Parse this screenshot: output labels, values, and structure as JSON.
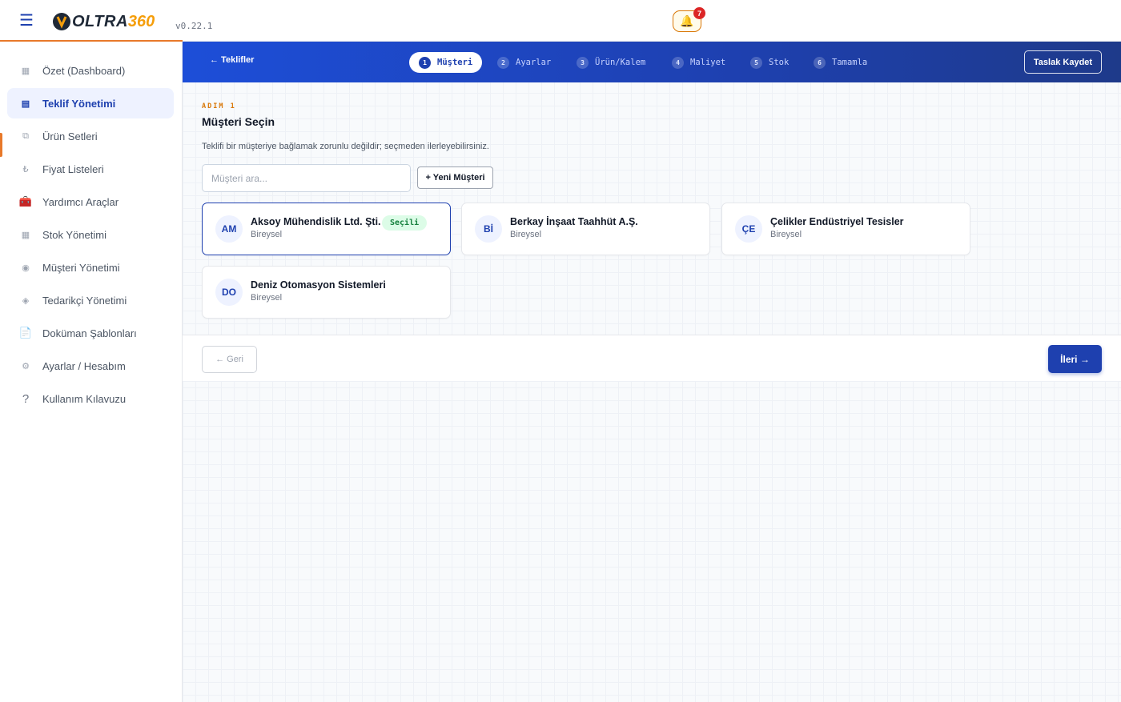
{
  "header": {
    "logo_word": "OLTRA",
    "logo_num": "360",
    "version": "v0.22.1",
    "notification_count": "7"
  },
  "sidebar": {
    "items": [
      {
        "label": "Özet (Dashboard)",
        "icon": "dashboard-icon"
      },
      {
        "label": "Teklif Yönetimi",
        "icon": "document-list-icon",
        "active": true
      },
      {
        "label": "Ürün Setleri",
        "icon": "box-icon"
      },
      {
        "label": "Fiyat Listeleri",
        "icon": "lira-icon"
      },
      {
        "label": "Yardımcı Araçlar",
        "icon": "toolbox-icon"
      },
      {
        "label": "Stok Yönetimi",
        "icon": "grid-icon"
      },
      {
        "label": "Müşteri Yönetimi",
        "icon": "target-icon"
      },
      {
        "label": "Tedarikçi Yönetimi",
        "icon": "diamond-icon"
      },
      {
        "label": "Doküman Şablonları",
        "icon": "file-icon"
      },
      {
        "label": "Ayarlar / Hesabım",
        "icon": "gear-icon"
      },
      {
        "label": "Kullanım Kılavuzu",
        "icon": "help-icon"
      }
    ]
  },
  "stepbar": {
    "back_label": "← Teklifler",
    "draft_label": "Taslak Kaydet",
    "steps": [
      {
        "num": "1",
        "label": "Müşteri",
        "active": true
      },
      {
        "num": "2",
        "label": "Ayarlar"
      },
      {
        "num": "3",
        "label": "Ürün/Kalem"
      },
      {
        "num": "4",
        "label": "Maliyet"
      },
      {
        "num": "5",
        "label": "Stok"
      },
      {
        "num": "6",
        "label": "Tamamla"
      }
    ]
  },
  "content": {
    "kicker": "ADIM 1",
    "title": "Müşteri Seçin",
    "description": "Teklifi bir müşteriye bağlamak zorunlu değildir; seçmeden ilerleyebilirsiniz.",
    "search_placeholder": "Müşteri ara...",
    "new_customer_label": "+ Yeni Müşteri",
    "selected_badge": "Seçili",
    "customers": [
      {
        "initials": "AM",
        "name": "Aksoy Mühendislik Ltd. Şti.",
        "type": "Bireysel",
        "selected": true
      },
      {
        "initials": "Bİ",
        "name": "Berkay İnşaat Taahhüt A.Ş.",
        "type": "Bireysel"
      },
      {
        "initials": "ÇE",
        "name": "Çelikler Endüstriyel Tesisler",
        "type": "Bireysel"
      },
      {
        "initials": "DO",
        "name": "Deniz Otomasyon Sistemleri",
        "type": "Bireysel"
      }
    ]
  },
  "footer": {
    "back_label": "← Geri",
    "next_label": "İleri →"
  },
  "colors": {
    "brand": "#1e40af",
    "accent": "#e8792a",
    "success": "#15803d"
  }
}
